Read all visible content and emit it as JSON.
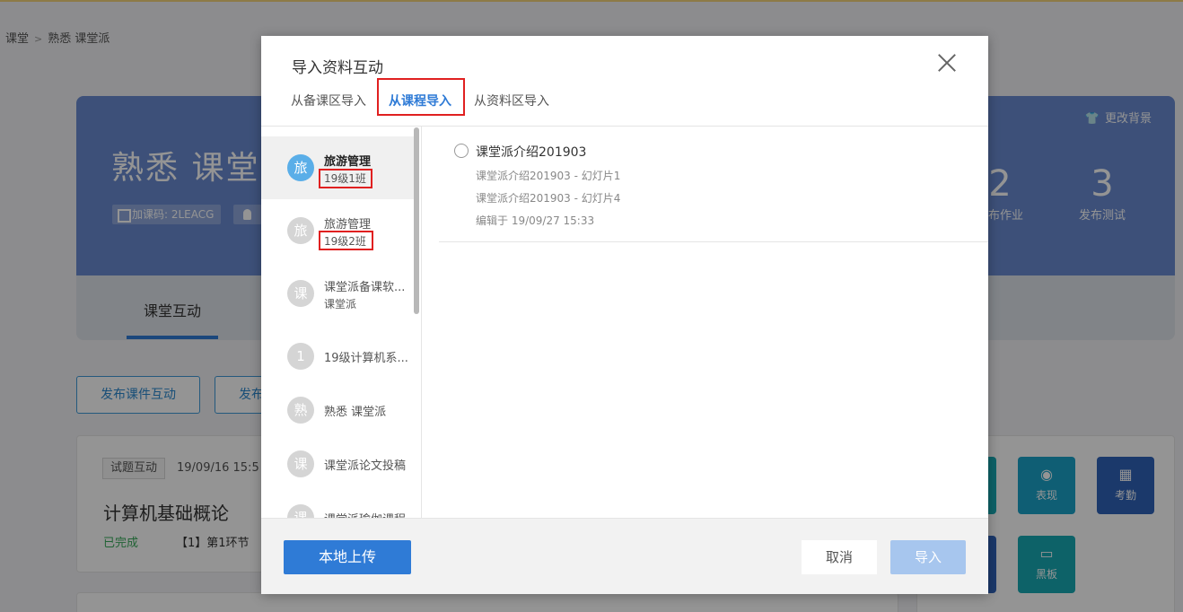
{
  "breadcrumb": {
    "items": [
      "课堂",
      "熟悉 课堂派"
    ],
    "separator": ">"
  },
  "banner": {
    "title": "熟悉 课堂派",
    "join_code": "加课码: 2LEACG",
    "change_bg": "更改背景",
    "stats": [
      {
        "num": "2",
        "label": "发布作业"
      },
      {
        "num": "3",
        "label": "发布测试"
      }
    ]
  },
  "tabs": {
    "active": "课堂互动"
  },
  "actions": {
    "publish_courseware": "发布课件互动",
    "publish_other": "发布"
  },
  "card": {
    "tag": "试题互动",
    "time": "19/09/16  15:5",
    "title": "计算机基础概论",
    "status": "已完成",
    "segment": "【1】第1环节"
  },
  "tools": [
    {
      "label": "表现",
      "icon": "medal-icon",
      "color": "#1aa3c8"
    },
    {
      "label": "考勤",
      "icon": "calendar-icon",
      "color": "#2f63b8"
    },
    {
      "label": "黑板",
      "icon": "blackboard-icon",
      "color": "#17a9b3"
    }
  ],
  "modal": {
    "title": "导入资料互动",
    "tabs": [
      "从备课区导入",
      "从课程导入",
      "从资料区导入"
    ],
    "active_tab": 1,
    "courses": [
      {
        "avatar": "旅",
        "name": "旅游管理",
        "sub": "19级1班",
        "selected": true
      },
      {
        "avatar": "旅",
        "name": "旅游管理",
        "sub": "19级2班"
      },
      {
        "avatar": "课",
        "name": "课堂派备课软...",
        "sub": "课堂派"
      },
      {
        "avatar": "1",
        "name": "19级计算机系..."
      },
      {
        "avatar": "熟",
        "name": "熟悉 课堂派"
      },
      {
        "avatar": "课",
        "name": "课堂派论文投稿"
      },
      {
        "avatar": "课",
        "name": "课堂派瑜伽课程"
      }
    ],
    "item": {
      "title": "课堂派介绍201903",
      "lines": [
        "课堂派介绍201903 - 幻灯片1",
        "课堂派介绍201903 - 幻灯片4"
      ],
      "edited": "编辑于 19/09/27 15:33"
    },
    "buttons": {
      "upload": "本地上传",
      "cancel": "取消",
      "import": "导入"
    }
  }
}
